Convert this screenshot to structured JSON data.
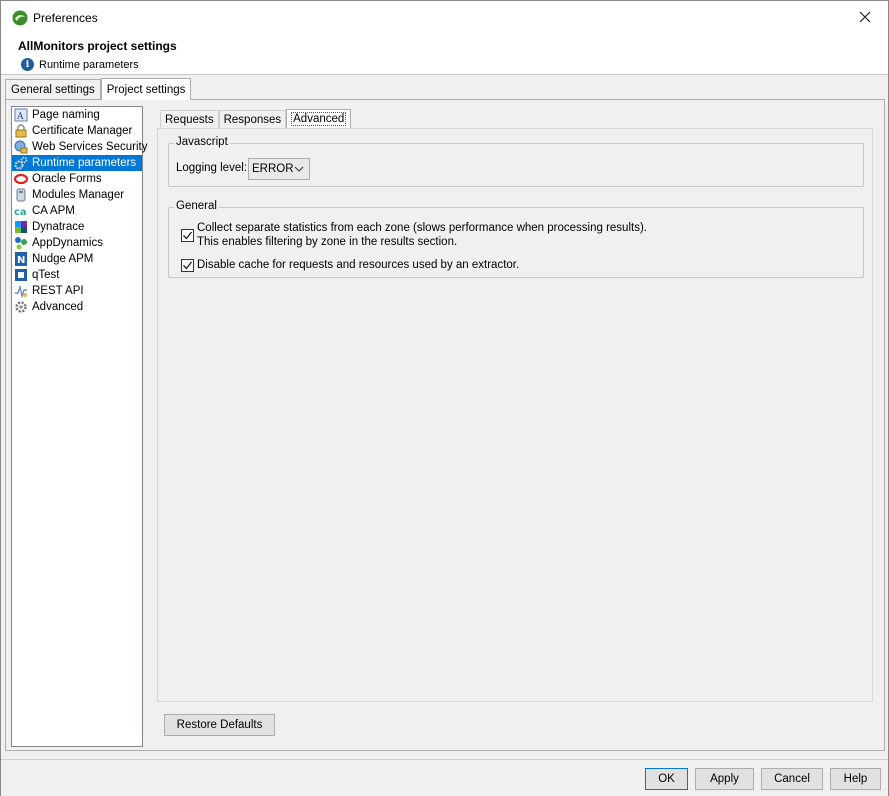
{
  "window": {
    "title": "Preferences"
  },
  "header": {
    "title": "AllMonitors project settings",
    "subtitle": "Runtime parameters"
  },
  "outer_tabs": [
    {
      "label": "General settings",
      "active": false
    },
    {
      "label": "Project settings",
      "active": true
    }
  ],
  "tree": {
    "items": [
      {
        "label": "Page naming",
        "icon": "page-naming-icon"
      },
      {
        "label": "Certificate Manager",
        "icon": "certificate-icon"
      },
      {
        "label": "Web Services Security",
        "icon": "web-security-icon"
      },
      {
        "label": "Runtime parameters",
        "icon": "runtime-gear-icon",
        "selected": true
      },
      {
        "label": "Oracle Forms",
        "icon": "oracle-icon"
      },
      {
        "label": "Modules Manager",
        "icon": "modules-icon"
      },
      {
        "label": "CA APM",
        "icon": "ca-apm-icon"
      },
      {
        "label": "Dynatrace",
        "icon": "dynatrace-icon"
      },
      {
        "label": "AppDynamics",
        "icon": "appdynamics-icon"
      },
      {
        "label": "Nudge APM",
        "icon": "nudge-icon"
      },
      {
        "label": "qTest",
        "icon": "qtest-icon"
      },
      {
        "label": "REST API",
        "icon": "rest-api-icon"
      },
      {
        "label": "Advanced",
        "icon": "advanced-gear-icon"
      }
    ]
  },
  "inner_tabs": [
    {
      "label": "Requests",
      "active": false
    },
    {
      "label": "Responses",
      "active": false
    },
    {
      "label": "Advanced",
      "active": true
    }
  ],
  "javascript_group": {
    "title": "Javascript",
    "logging_label": "Logging level:",
    "logging_value": "ERROR"
  },
  "general_group": {
    "title": "General",
    "option1_line1": "Collect separate statistics from each zone (slows performance when processing results).",
    "option1_line2": "This enables filtering by zone in the results section.",
    "option1_checked": true,
    "option2": "Disable cache for requests and resources used by an extractor.",
    "option2_checked": true
  },
  "restore_defaults": "Restore Defaults",
  "footer": {
    "ok": "OK",
    "apply": "Apply",
    "cancel": "Cancel",
    "help": "Help"
  },
  "colors": {
    "selection": "#0078d7",
    "dialog_bg": "#f0f0f0"
  }
}
